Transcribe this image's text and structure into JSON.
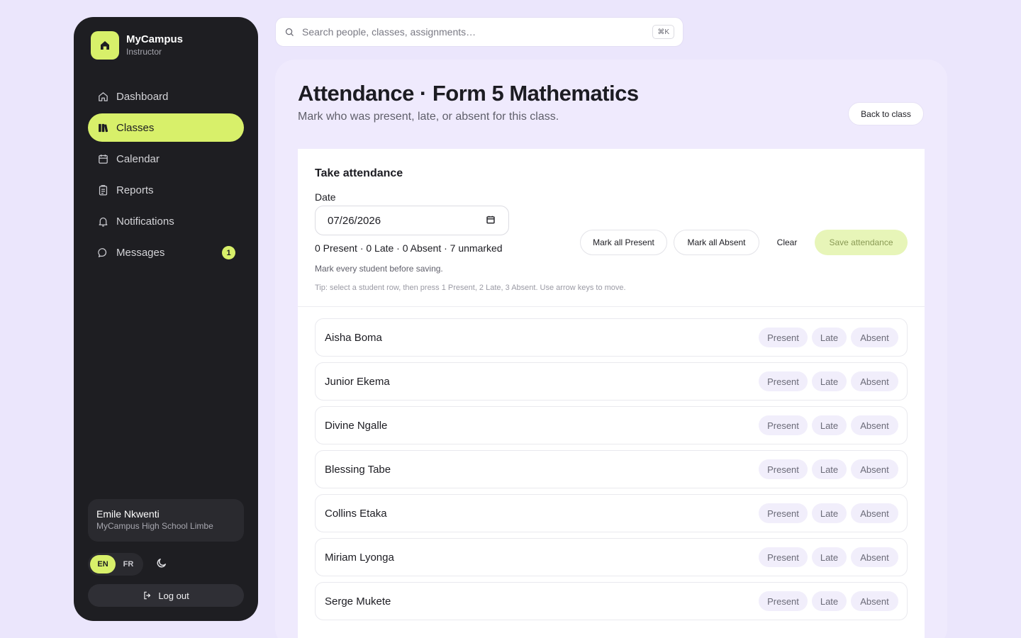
{
  "brand": {
    "name": "MyCampus",
    "role": "Instructor"
  },
  "nav": {
    "items": [
      {
        "label": "Dashboard",
        "icon": "home-icon",
        "active": false
      },
      {
        "label": "Classes",
        "icon": "books-icon",
        "active": true
      },
      {
        "label": "Calendar",
        "icon": "calendar-icon",
        "active": false
      },
      {
        "label": "Reports",
        "icon": "clipboard-icon",
        "active": false
      },
      {
        "label": "Notifications",
        "icon": "bell-icon",
        "active": false
      },
      {
        "label": "Messages",
        "icon": "chat-icon",
        "active": false,
        "badge": "1"
      }
    ]
  },
  "user": {
    "name": "Emile Nkwenti",
    "school": "MyCampus High School Limbe"
  },
  "lang": {
    "en": "EN",
    "fr": "FR",
    "active": "EN"
  },
  "logout_label": "Log out",
  "search": {
    "placeholder": "Search people, classes, assignments…",
    "shortcut": "⌘K"
  },
  "page": {
    "title": "Attendance · Form 5 Mathematics",
    "subtitle": "Mark who was present, late, or absent for this class.",
    "back_label": "Back to class"
  },
  "attendance": {
    "card_title": "Take attendance",
    "date_label": "Date",
    "date_value": "07/26/2026",
    "summary": "0 Present · 0 Late · 0 Absent · 7 unmarked",
    "hint": "Mark every student before saving.",
    "tip": "Tip: select a student row, then press 1 Present, 2 Late, 3 Absent. Use arrow keys to move.",
    "mark_all_present": "Mark all Present",
    "mark_all_absent": "Mark all Absent",
    "clear": "Clear",
    "save": "Save attendance",
    "status_labels": {
      "present": "Present",
      "late": "Late",
      "absent": "Absent"
    },
    "students": [
      {
        "name": "Aisha Boma"
      },
      {
        "name": "Junior Ekema"
      },
      {
        "name": "Divine Ngalle"
      },
      {
        "name": "Blessing Tabe"
      },
      {
        "name": "Collins Etaka"
      },
      {
        "name": "Miriam Lyonga"
      },
      {
        "name": "Serge Mukete"
      }
    ]
  },
  "colors": {
    "accent": "#d8f06a",
    "sidebar": "#1e1e22",
    "background": "#ebe6fc",
    "pill": "#f1eefb"
  }
}
